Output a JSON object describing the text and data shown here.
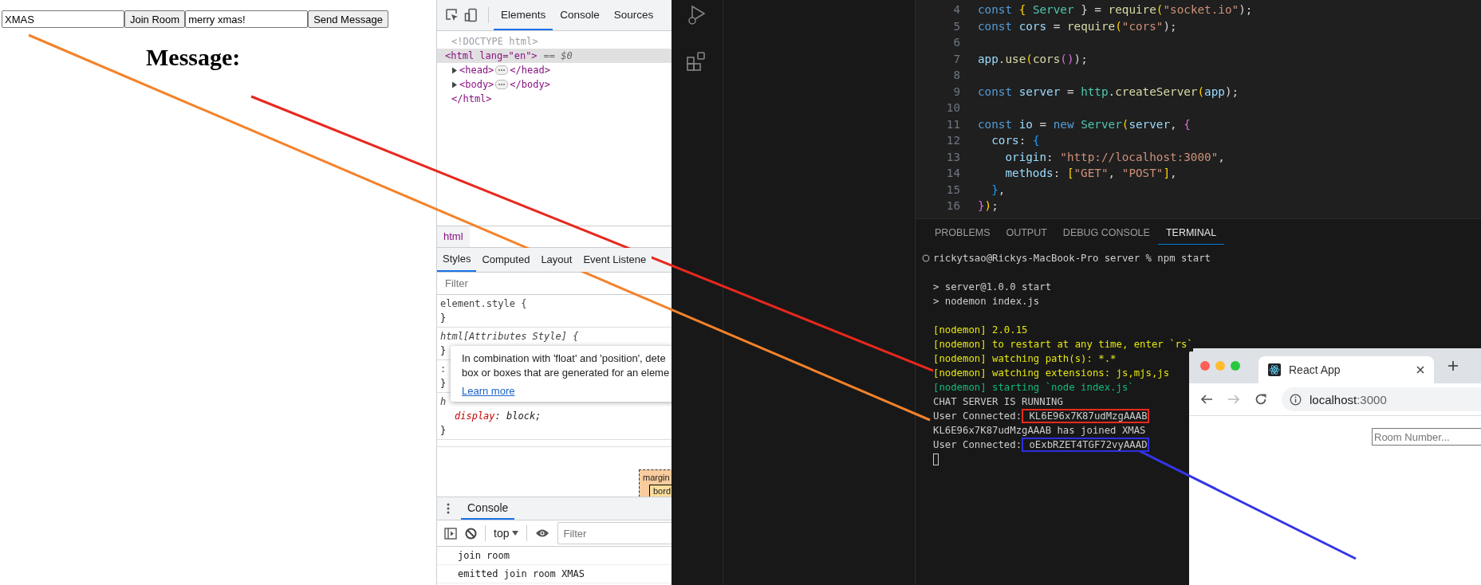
{
  "web_page": {
    "room_field": {
      "value": "XMAS"
    },
    "join_button": "Join Room",
    "message_field": {
      "value": "merry xmas!"
    },
    "send_button": "Send Message",
    "heading": "Message:"
  },
  "devtools": {
    "tabs": [
      {
        "label": "Elements",
        "selected": true
      },
      {
        "label": "Console",
        "selected": false
      },
      {
        "label": "Sources",
        "selected": false
      }
    ],
    "dom_tree": [
      {
        "kind": "doctype",
        "text": "<!DOCTYPE html>",
        "selected": false
      },
      {
        "kind": "open",
        "text": "<html lang=\"en\">",
        "suffix": "== $0",
        "selected": true
      },
      {
        "kind": "collapsed",
        "open": "<head>",
        "close": "</head>",
        "selected": false
      },
      {
        "kind": "collapsed",
        "open": "<body>",
        "close": "</body>",
        "selected": false
      },
      {
        "kind": "close",
        "text": "</html>",
        "selected": false
      }
    ],
    "breadcrumb": "html",
    "style_tabs": [
      {
        "label": "Styles",
        "selected": true
      },
      {
        "label": "Computed",
        "selected": false
      },
      {
        "label": "Layout",
        "selected": false
      },
      {
        "label": "Event Listene",
        "selected": false
      }
    ],
    "filter_placeholder": "Filter",
    "rules": [
      {
        "selector": "element.style {",
        "italic": false,
        "close": "}"
      },
      {
        "selector": "html[Attributes Style] {",
        "italic": true,
        "close": "}"
      },
      {
        "selector": ":",
        "italic": false,
        "close": "}"
      },
      {
        "selector": "h",
        "italic": true,
        "declarations": [
          {
            "property": "display",
            "separator": ":",
            "value": "block;"
          }
        ],
        "close": "}"
      }
    ],
    "tooltip": {
      "lines": [
        "In combination with 'float' and 'position', dete",
        "box or boxes that are generated for an eleme"
      ],
      "link": "Learn more"
    },
    "box_model": {
      "margin": "margin",
      "border": "bord"
    },
    "drawer_tab": "Console",
    "console_context": "top",
    "console_filter_placeholder": "Filter",
    "console_messages": [
      "join room",
      "emitted join room XMAS"
    ]
  },
  "editor": {
    "lines": [
      {
        "number": "4",
        "tokens": [
          {
            "text": "const",
            "kind": "keyword"
          },
          {
            "text": " { ",
            "kind": "bracket"
          },
          {
            "text": "Server",
            "kind": "type"
          },
          {
            "text": " } = ",
            "kind": "plain"
          },
          {
            "text": "require",
            "kind": "function"
          },
          {
            "text": "(",
            "kind": "bracket"
          },
          {
            "text": "\"socket.io\"",
            "kind": "string"
          },
          {
            "text": ");",
            "kind": "plain"
          }
        ]
      },
      {
        "number": "5",
        "tokens": [
          {
            "text": "const",
            "kind": "keyword"
          },
          {
            "text": " cors",
            "kind": "variable"
          },
          {
            "text": " = ",
            "kind": "plain"
          },
          {
            "text": "require",
            "kind": "function"
          },
          {
            "text": "(",
            "kind": "bracket"
          },
          {
            "text": "\"cors\"",
            "kind": "string"
          },
          {
            "text": ");",
            "kind": "plain"
          }
        ]
      },
      {
        "number": "6"
      },
      {
        "number": "7",
        "tokens": [
          {
            "text": "app",
            "kind": "variable"
          },
          {
            "text": ".",
            "kind": "plain"
          },
          {
            "text": "use",
            "kind": "function"
          },
          {
            "text": "(",
            "kind": "bracket"
          },
          {
            "text": "cors",
            "kind": "function"
          },
          {
            "text": "()",
            "kind": "bracket2"
          },
          {
            "text": ");",
            "kind": "plain"
          }
        ]
      },
      {
        "number": "8"
      },
      {
        "number": "9",
        "tokens": [
          {
            "text": "const",
            "kind": "keyword"
          },
          {
            "text": " server",
            "kind": "variable"
          },
          {
            "text": " = ",
            "kind": "plain"
          },
          {
            "text": "http",
            "kind": "type"
          },
          {
            "text": ".",
            "kind": "plain"
          },
          {
            "text": "createServer",
            "kind": "function"
          },
          {
            "text": "(",
            "kind": "bracket"
          },
          {
            "text": "app",
            "kind": "variable"
          },
          {
            "text": ");",
            "kind": "plain"
          }
        ]
      },
      {
        "number": "10"
      },
      {
        "number": "11",
        "tokens": [
          {
            "text": "const",
            "kind": "keyword"
          },
          {
            "text": " io",
            "kind": "variable"
          },
          {
            "text": " = ",
            "kind": "plain"
          },
          {
            "text": "new",
            "kind": "keyword"
          },
          {
            "text": " Server",
            "kind": "type"
          },
          {
            "text": "(",
            "kind": "bracket"
          },
          {
            "text": "server",
            "kind": "variable"
          },
          {
            "text": ", ",
            "kind": "plain"
          },
          {
            "text": "{",
            "kind": "bracket2"
          }
        ]
      },
      {
        "number": "12",
        "tokens": [
          {
            "text": "  cors",
            "kind": "variable"
          },
          {
            "text": ": ",
            "kind": "plain"
          },
          {
            "text": "{",
            "kind": "bracket3"
          }
        ]
      },
      {
        "number": "13",
        "tokens": [
          {
            "text": "    origin",
            "kind": "variable"
          },
          {
            "text": ": ",
            "kind": "plain"
          },
          {
            "text": "\"http://localhost:3000\"",
            "kind": "string"
          },
          {
            "text": ",",
            "kind": "plain"
          }
        ]
      },
      {
        "number": "14",
        "tokens": [
          {
            "text": "    methods",
            "kind": "variable"
          },
          {
            "text": ": ",
            "kind": "plain"
          },
          {
            "text": "[",
            "kind": "bracket"
          },
          {
            "text": "\"GET\"",
            "kind": "string"
          },
          {
            "text": ", ",
            "kind": "plain"
          },
          {
            "text": "\"POST\"",
            "kind": "string"
          },
          {
            "text": "]",
            "kind": "bracket"
          },
          {
            "text": ",",
            "kind": "plain"
          }
        ]
      },
      {
        "number": "15",
        "tokens": [
          {
            "text": "  }",
            "kind": "bracket3"
          },
          {
            "text": ",",
            "kind": "plain"
          }
        ]
      },
      {
        "number": "16",
        "tokens": [
          {
            "text": "}",
            "kind": "bracket2"
          },
          {
            "text": ")",
            "kind": "bracket"
          },
          {
            "text": ";",
            "kind": "plain"
          }
        ]
      }
    ]
  },
  "panel_tabs": [
    {
      "label": "PROBLEMS",
      "selected": false
    },
    {
      "label": "OUTPUT",
      "selected": false
    },
    {
      "label": "DEBUG CONSOLE",
      "selected": false
    },
    {
      "label": "TERMINAL",
      "selected": true
    }
  ],
  "terminal": {
    "blocks": [
      [
        {
          "kind": "prompt",
          "segments": [
            {
              "text": "rickytsao@Rickys-MacBook-Pro server % npm start"
            }
          ]
        }
      ],
      [
        {
          "kind": "plain",
          "segments": [
            {
              "text": "> server@1.0.0 start"
            }
          ]
        },
        {
          "kind": "plain",
          "segments": [
            {
              "text": "> nodemon index.js"
            }
          ]
        }
      ],
      [
        {
          "kind": "yellow",
          "segments": [
            {
              "text": "[nodemon] 2.0.15"
            }
          ]
        },
        {
          "kind": "yellow",
          "segments": [
            {
              "text": "[nodemon] to restart at any time, enter `rs`"
            }
          ]
        },
        {
          "kind": "yellow",
          "segments": [
            {
              "text": "[nodemon] watching path(s): *.*"
            }
          ]
        },
        {
          "kind": "yellow",
          "segments": [
            {
              "text": "[nodemon] watching extensions: js,mjs,js"
            }
          ]
        },
        {
          "kind": "green",
          "segments": [
            {
              "text": "[nodemon] starting `node index.js`"
            }
          ]
        },
        {
          "kind": "plain",
          "segments": [
            {
              "text": "CHAT SERVER IS RUNNING"
            }
          ]
        },
        {
          "kind": "plain",
          "segments": [
            {
              "text": "User Connected:"
            },
            {
              "text": " KL6E96x7K87udMzgAAAB",
              "color": "#e8281e"
            }
          ]
        },
        {
          "kind": "plain",
          "segments": [
            {
              "text": "KL6E96x7K87udMzgAAAB has joined XMAS"
            }
          ]
        },
        {
          "kind": "plain",
          "segments": [
            {
              "text": "User Connected:"
            },
            {
              "text": " oExbRZET4TGF72vyAAAD",
              "color": "#2e2ee0"
            }
          ]
        },
        {
          "kind": "cursor"
        }
      ]
    ]
  },
  "browser": {
    "tab_title": "React App",
    "url_host": "localhost",
    "url_port": ":3000",
    "forward_disabled": true,
    "room_placeholder": "Room Number..."
  },
  "annotations": [
    {
      "color": "#f4822a"
    },
    {
      "color": "#e8281e"
    },
    {
      "color": "#3535e8"
    }
  ]
}
